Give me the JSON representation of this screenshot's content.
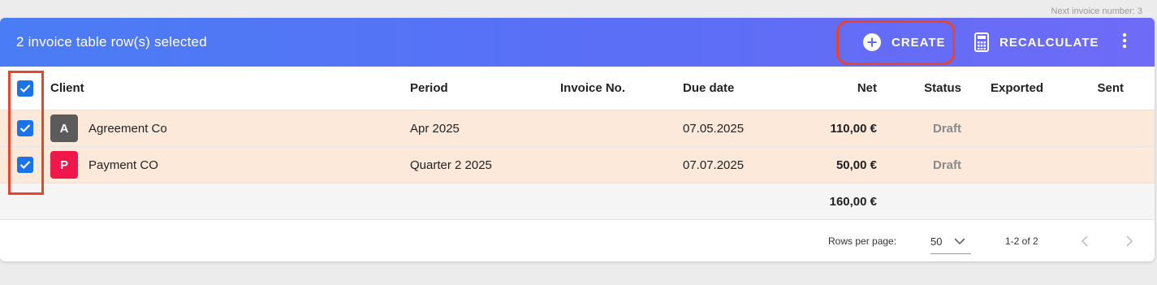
{
  "next_invoice_label": "Next invoice number: 3",
  "toolbar": {
    "selection_text": "2 invoice table row(s) selected",
    "create_label": "CREATE",
    "recalculate_label": "RECALCULATE",
    "icons": [
      "plus-circle-icon",
      "calculator-icon",
      "more-vert-icon"
    ]
  },
  "table": {
    "columns": {
      "client": "Client",
      "period": "Period",
      "invoice_no": "Invoice No.",
      "due_date": "Due date",
      "net": "Net",
      "status": "Status",
      "exported": "Exported",
      "sent": "Sent"
    },
    "rows": [
      {
        "avatar": "A",
        "client": "Agreement Co",
        "period": "Apr 2025",
        "invoice_no": "",
        "due_date": "07.05.2025",
        "net": "110,00 €",
        "status": "Draft",
        "exported": "",
        "sent": "",
        "selected": true
      },
      {
        "avatar": "P",
        "client": "Payment CO",
        "period": "Quarter 2 2025",
        "invoice_no": "",
        "due_date": "07.07.2025",
        "net": "50,00 €",
        "status": "Draft",
        "exported": "",
        "sent": "",
        "selected": true
      }
    ],
    "total_net": "160,00 €"
  },
  "pagination": {
    "rows_per_page_label": "Rows per page:",
    "rows_per_page_value": "50",
    "range_text": "1-2 of 2"
  },
  "colors": {
    "toolbar_start": "#4a7df5",
    "toolbar_end": "#6e6bf7",
    "selected_row": "#fde9da",
    "checkbox": "#1a73e8",
    "highlight": "#e8452c",
    "avatar_a": "#5b5b5b",
    "avatar_p": "#f0184b"
  }
}
